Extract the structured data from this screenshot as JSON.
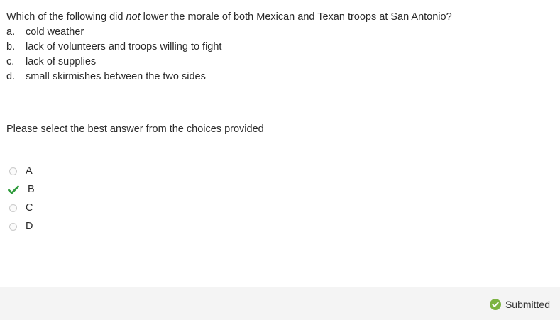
{
  "question": {
    "text_before": "Which of the following did ",
    "text_emphasis": "not",
    "text_after": " lower the morale of both Mexican and Texan troops at San Antonio?",
    "choices": [
      {
        "letter": "a.",
        "text": "cold weather"
      },
      {
        "letter": "b.",
        "text": "lack of volunteers and troops willing to fight"
      },
      {
        "letter": "c.",
        "text": "lack of supplies"
      },
      {
        "letter": "d.",
        "text": "small skirmishes between the two sides"
      }
    ]
  },
  "instruction": "Please select the best answer from the choices provided",
  "answers": {
    "options": [
      {
        "label": "A",
        "state": "unselected"
      },
      {
        "label": "B",
        "state": "selected-correct"
      },
      {
        "label": "C",
        "state": "unselected"
      },
      {
        "label": "D",
        "state": "unselected"
      }
    ],
    "selected": "B"
  },
  "footer": {
    "status": "Submitted"
  },
  "colors": {
    "check_green": "#2e9b3b",
    "submitted_badge": "#7cb342",
    "text": "#2b2b2b",
    "footer_bg": "#f4f4f4"
  },
  "icons": {
    "selected_marker": "checkmark-icon",
    "status_icon": "check-circle-icon"
  }
}
